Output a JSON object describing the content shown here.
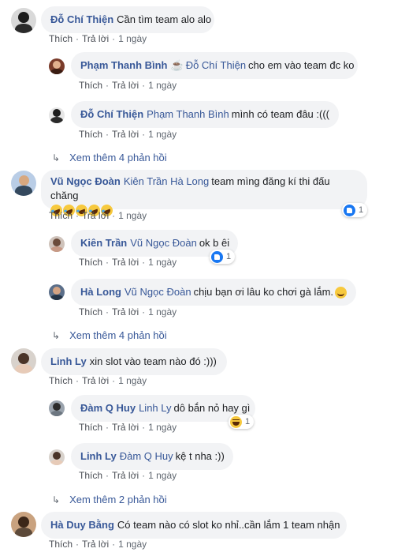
{
  "common": {
    "like": "Thích",
    "reply": "Trả lời",
    "sep": "·",
    "time": "1 ngày",
    "arrow": "↳"
  },
  "comments": [
    {
      "author": "Đỗ Chí Thiện",
      "text": "Cần tìm team alo alo",
      "replies": [
        {
          "author": "Phạm Thanh Bình",
          "tag_prefix": "☕",
          "tag": "Đỗ Chí Thiện",
          "text": "cho em vào team đc ko"
        },
        {
          "author": "Đỗ Chí Thiện",
          "tag": "Phạm Thanh Bình",
          "text": "mình có team đâu :((("
        }
      ],
      "more_replies": "Xem thêm 4 phản hồi"
    },
    {
      "author": "Vũ Ngọc Đoàn",
      "tag": "Kiên Trần Hà Long",
      "text": "team mìng đăng kí thi đấu chăng",
      "emoji": [
        "haha",
        "haha",
        "haha",
        "haha",
        "haha"
      ],
      "reaction": {
        "icon": "like-icon",
        "count": "1"
      },
      "replies": [
        {
          "author": "Kiên Trần",
          "tag": "Vũ Ngọc Đoàn",
          "text": "ok b êi",
          "reaction": {
            "icon": "like-icon",
            "count": "1"
          }
        },
        {
          "author": "Hà Long",
          "tag": "Vũ Ngọc Đoàn",
          "text": "chịu bạn ơi lâu ko chơi gà lắm.",
          "emoji": "smile"
        }
      ],
      "more_replies": "Xem thêm 4 phản hồi"
    },
    {
      "author": "Linh Ly",
      "text": "xin slot vào team nào đó :)))",
      "replies": [
        {
          "author": "Đàm Q Huy",
          "tag": "Linh Ly",
          "text": "dô bắn nỏ hay gì",
          "reaction": {
            "icon": "haha-icon",
            "count": "1"
          }
        },
        {
          "author": "Linh Ly",
          "tag": "Đàm Q Huy",
          "text": "kệ t nha :))"
        }
      ],
      "more_replies": "Xem thêm 2 phản hồi"
    },
    {
      "author": "Hà Duy Bằng",
      "text": "Có team nào có slot ko nhỉ..cần lắm 1 team nhận"
    }
  ],
  "colors": {
    "author": "#385898",
    "bubble": "#f2f3f5",
    "meta": "#606770",
    "like_blue": "#1877f2"
  }
}
